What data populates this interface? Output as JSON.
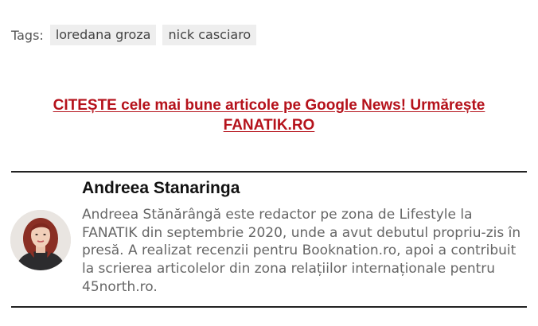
{
  "tags": {
    "label": "Tags:",
    "items": [
      "loredana groza",
      "nick casciaro"
    ]
  },
  "cta": {
    "text": "CITEȘTE cele mai bune articole pe Google News! Urmărește FANATIK.RO"
  },
  "author": {
    "name": "Andreea Stanaringa",
    "bio": "Andreea Stănărângă este redactor pe zona de Lifestyle la FANATIK din septembrie 2020, unde a avut debutul propriu-zis în presă. A realizat recenzii pentru Booknation.ro, apoi a contribuit la scrierea articolelor din zona relațiilor internaționale pentru 45north.ro."
  },
  "colors": {
    "accent": "#b5121b",
    "tag_bg": "#eeeeee",
    "rule": "#222222"
  }
}
